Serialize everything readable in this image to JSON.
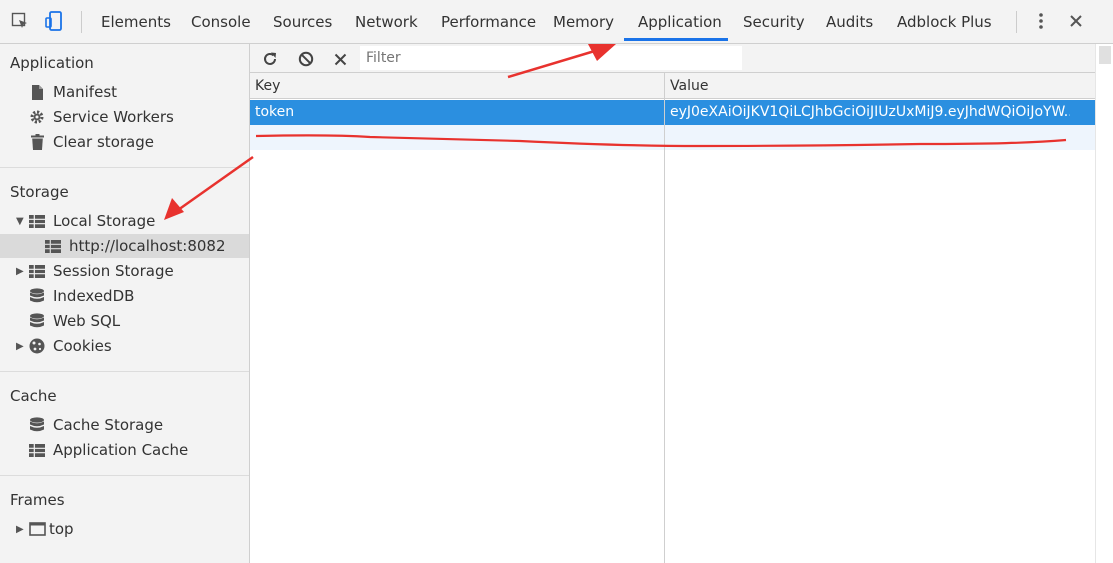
{
  "tabs": [
    "Elements",
    "Console",
    "Sources",
    "Network",
    "Performance",
    "Memory",
    "Application",
    "Security",
    "Audits",
    "Adblock Plus"
  ],
  "active_tab": "Application",
  "sidebar": {
    "application": {
      "title": "Application",
      "items": [
        "Manifest",
        "Service Workers",
        "Clear storage"
      ]
    },
    "storage": {
      "title": "Storage",
      "local_storage": "Local Storage",
      "local_origin": "http://localhost:8082",
      "session_storage": "Session Storage",
      "indexeddb": "IndexedDB",
      "websql": "Web SQL",
      "cookies": "Cookies"
    },
    "cache": {
      "title": "Cache",
      "cache_storage": "Cache Storage",
      "app_cache": "Application Cache"
    },
    "frames": {
      "title": "Frames",
      "top": "top"
    }
  },
  "toolbar": {
    "filter_placeholder": "Filter"
  },
  "table": {
    "columns": [
      "Key",
      "Value"
    ],
    "rows": [
      {
        "key": "token",
        "value": "eyJ0eXAiOiJKV1QiLCJhbGciOiJIUzUxMiJ9.eyJhdWQiOiJoYW..."
      }
    ]
  },
  "colors": {
    "accent": "#1a73e8",
    "selected_row": "#2b8fe0",
    "annotation": "#e8322e"
  }
}
